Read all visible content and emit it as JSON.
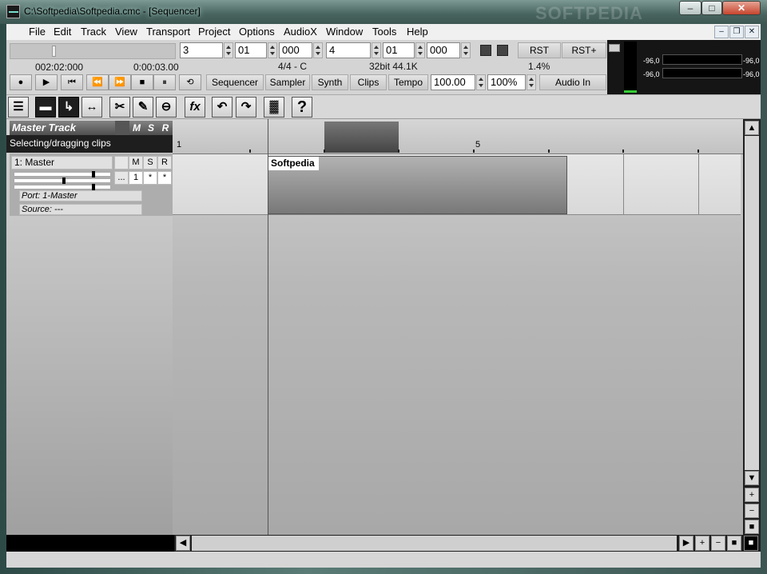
{
  "window": {
    "title": "C:\\Softpedia\\Softpedia.cmc - [Sequencer]",
    "min": "–",
    "max": "□",
    "close": "✕",
    "watermark": "SOFTPEDIA"
  },
  "menu": [
    "File",
    "Edit",
    "Track",
    "View",
    "Transport",
    "Project",
    "Options",
    "AudioX",
    "Window",
    "Tools",
    "Help"
  ],
  "mdi": {
    "min": "–",
    "restore": "❐",
    "close": "✕"
  },
  "transport": {
    "position": "002:02:000",
    "time": "0:00:03.00",
    "field1": "3",
    "field2": "01",
    "field3": "000",
    "field4": "4",
    "field5": "01",
    "field6": "000",
    "signature": "4/4 - C",
    "format": "32bit 44.1K",
    "cpu": "1.4%",
    "rst": "RST",
    "rst_plus": "RST+",
    "tempo_value": "100.00",
    "zoom_value": "100%",
    "audio_in": "Audio In",
    "tabs": [
      "Sequencer",
      "Sampler",
      "Synth",
      "Clips",
      "Tempo"
    ],
    "buttons": {
      "record": "●",
      "play": "▶",
      "begin": "⏮",
      "rewind": "⏪",
      "forward": "⏩",
      "stop": "■",
      "pause": "⏸",
      "loop": "⟲"
    }
  },
  "meter": {
    "left_db": "-96,0",
    "right_db": "-96,0",
    "left_db2": "-96,0",
    "right_db2": "-96,0"
  },
  "tools": {
    "list": "☰",
    "arrange": "▬",
    "select": "↳",
    "stretch": "↔",
    "cut": "✂",
    "paint": "✎",
    "mute": "⊖",
    "fx": "fx",
    "undo": "↶",
    "redo": "↷",
    "wave": "▓",
    "help": "?"
  },
  "master": {
    "title": "Master Track",
    "m": "M",
    "s": "S",
    "r": "R",
    "mode": "Selecting/dragging clips"
  },
  "track1": {
    "name": "1: Master",
    "m": "M",
    "s": "S",
    "r": "R",
    "more": "...",
    "num": "1",
    "star1": "*",
    "star2": "*",
    "port": "Port: 1-Master",
    "source": "Source: ---"
  },
  "ruler": {
    "bar1": "1",
    "bar5": "5"
  },
  "clip": {
    "name": "Softpedia"
  },
  "scroll": {
    "up": "▲",
    "down": "▼",
    "plus": "+",
    "minus": "−",
    "dot": "■",
    "left": "◀",
    "right": "▶"
  }
}
